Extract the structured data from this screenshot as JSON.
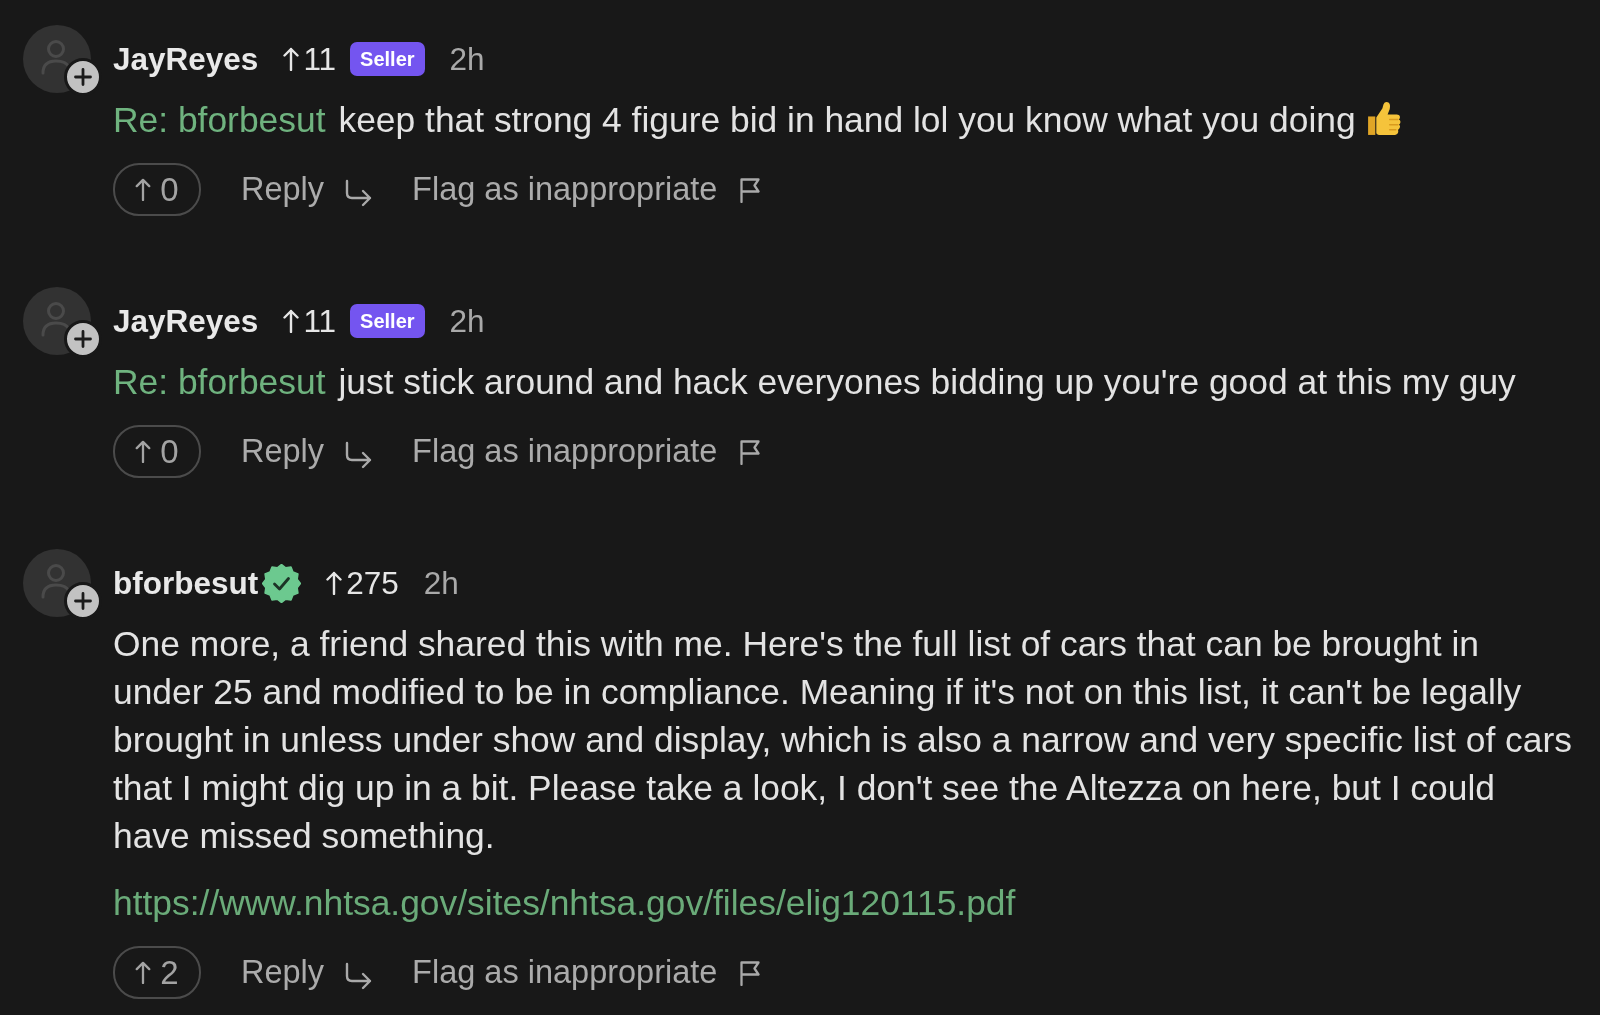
{
  "comments": [
    {
      "author": "JayReyes",
      "verified": false,
      "score": "11",
      "badge": "Seller",
      "time": "2h",
      "reply_to": "Re: bforbesut",
      "text": "keep that strong 4 figure bid in hand lol you know what you doing",
      "emoji": true,
      "votes": "0",
      "reply": "Reply",
      "flag": "Flag as inappropriate"
    },
    {
      "author": "JayReyes",
      "verified": false,
      "score": "11",
      "badge": "Seller",
      "time": "2h",
      "reply_to": "Re: bforbesut",
      "text": "just stick around and hack everyones bidding up you're good at this my guy",
      "emoji": false,
      "votes": "0",
      "reply": "Reply",
      "flag": "Flag as inappropriate"
    },
    {
      "author": "bforbesut",
      "verified": true,
      "score": "275",
      "time": "2h",
      "text": "One more, a friend shared this with me. Here's the full list of cars that can be brought in under 25 and modified to be in compliance. Meaning if it's not on this list, it can't be legally brought in unless under show and display, which is also a narrow and very specific list of cars that I might dig up in a bit. Please take a look, I don't see the Altezza on here, but I could have missed something.",
      "emoji": false,
      "link": "https://www.nhtsa.gov/sites/nhtsa.gov/files/elig120115.pdf",
      "votes": "2",
      "reply": "Reply",
      "flag": "Flag as inappropriate"
    }
  ]
}
